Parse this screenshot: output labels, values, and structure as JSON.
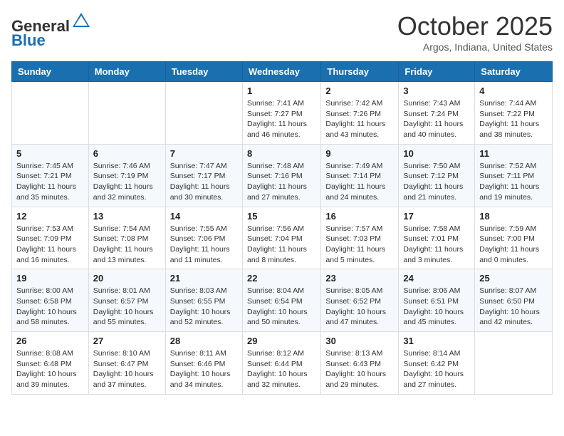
{
  "header": {
    "logo_general": "General",
    "logo_blue": "Blue",
    "month_title": "October 2025",
    "location": "Argos, Indiana, United States"
  },
  "calendar": {
    "days_of_week": [
      "Sunday",
      "Monday",
      "Tuesday",
      "Wednesday",
      "Thursday",
      "Friday",
      "Saturday"
    ],
    "weeks": [
      [
        {
          "day": "",
          "info": ""
        },
        {
          "day": "",
          "info": ""
        },
        {
          "day": "",
          "info": ""
        },
        {
          "day": "1",
          "info": "Sunrise: 7:41 AM\nSunset: 7:27 PM\nDaylight: 11 hours and 46 minutes."
        },
        {
          "day": "2",
          "info": "Sunrise: 7:42 AM\nSunset: 7:26 PM\nDaylight: 11 hours and 43 minutes."
        },
        {
          "day": "3",
          "info": "Sunrise: 7:43 AM\nSunset: 7:24 PM\nDaylight: 11 hours and 40 minutes."
        },
        {
          "day": "4",
          "info": "Sunrise: 7:44 AM\nSunset: 7:22 PM\nDaylight: 11 hours and 38 minutes."
        }
      ],
      [
        {
          "day": "5",
          "info": "Sunrise: 7:45 AM\nSunset: 7:21 PM\nDaylight: 11 hours and 35 minutes."
        },
        {
          "day": "6",
          "info": "Sunrise: 7:46 AM\nSunset: 7:19 PM\nDaylight: 11 hours and 32 minutes."
        },
        {
          "day": "7",
          "info": "Sunrise: 7:47 AM\nSunset: 7:17 PM\nDaylight: 11 hours and 30 minutes."
        },
        {
          "day": "8",
          "info": "Sunrise: 7:48 AM\nSunset: 7:16 PM\nDaylight: 11 hours and 27 minutes."
        },
        {
          "day": "9",
          "info": "Sunrise: 7:49 AM\nSunset: 7:14 PM\nDaylight: 11 hours and 24 minutes."
        },
        {
          "day": "10",
          "info": "Sunrise: 7:50 AM\nSunset: 7:12 PM\nDaylight: 11 hours and 21 minutes."
        },
        {
          "day": "11",
          "info": "Sunrise: 7:52 AM\nSunset: 7:11 PM\nDaylight: 11 hours and 19 minutes."
        }
      ],
      [
        {
          "day": "12",
          "info": "Sunrise: 7:53 AM\nSunset: 7:09 PM\nDaylight: 11 hours and 16 minutes."
        },
        {
          "day": "13",
          "info": "Sunrise: 7:54 AM\nSunset: 7:08 PM\nDaylight: 11 hours and 13 minutes."
        },
        {
          "day": "14",
          "info": "Sunrise: 7:55 AM\nSunset: 7:06 PM\nDaylight: 11 hours and 11 minutes."
        },
        {
          "day": "15",
          "info": "Sunrise: 7:56 AM\nSunset: 7:04 PM\nDaylight: 11 hours and 8 minutes."
        },
        {
          "day": "16",
          "info": "Sunrise: 7:57 AM\nSunset: 7:03 PM\nDaylight: 11 hours and 5 minutes."
        },
        {
          "day": "17",
          "info": "Sunrise: 7:58 AM\nSunset: 7:01 PM\nDaylight: 11 hours and 3 minutes."
        },
        {
          "day": "18",
          "info": "Sunrise: 7:59 AM\nSunset: 7:00 PM\nDaylight: 11 hours and 0 minutes."
        }
      ],
      [
        {
          "day": "19",
          "info": "Sunrise: 8:00 AM\nSunset: 6:58 PM\nDaylight: 10 hours and 58 minutes."
        },
        {
          "day": "20",
          "info": "Sunrise: 8:01 AM\nSunset: 6:57 PM\nDaylight: 10 hours and 55 minutes."
        },
        {
          "day": "21",
          "info": "Sunrise: 8:03 AM\nSunset: 6:55 PM\nDaylight: 10 hours and 52 minutes."
        },
        {
          "day": "22",
          "info": "Sunrise: 8:04 AM\nSunset: 6:54 PM\nDaylight: 10 hours and 50 minutes."
        },
        {
          "day": "23",
          "info": "Sunrise: 8:05 AM\nSunset: 6:52 PM\nDaylight: 10 hours and 47 minutes."
        },
        {
          "day": "24",
          "info": "Sunrise: 8:06 AM\nSunset: 6:51 PM\nDaylight: 10 hours and 45 minutes."
        },
        {
          "day": "25",
          "info": "Sunrise: 8:07 AM\nSunset: 6:50 PM\nDaylight: 10 hours and 42 minutes."
        }
      ],
      [
        {
          "day": "26",
          "info": "Sunrise: 8:08 AM\nSunset: 6:48 PM\nDaylight: 10 hours and 39 minutes."
        },
        {
          "day": "27",
          "info": "Sunrise: 8:10 AM\nSunset: 6:47 PM\nDaylight: 10 hours and 37 minutes."
        },
        {
          "day": "28",
          "info": "Sunrise: 8:11 AM\nSunset: 6:46 PM\nDaylight: 10 hours and 34 minutes."
        },
        {
          "day": "29",
          "info": "Sunrise: 8:12 AM\nSunset: 6:44 PM\nDaylight: 10 hours and 32 minutes."
        },
        {
          "day": "30",
          "info": "Sunrise: 8:13 AM\nSunset: 6:43 PM\nDaylight: 10 hours and 29 minutes."
        },
        {
          "day": "31",
          "info": "Sunrise: 8:14 AM\nSunset: 6:42 PM\nDaylight: 10 hours and 27 minutes."
        },
        {
          "day": "",
          "info": ""
        }
      ]
    ]
  }
}
